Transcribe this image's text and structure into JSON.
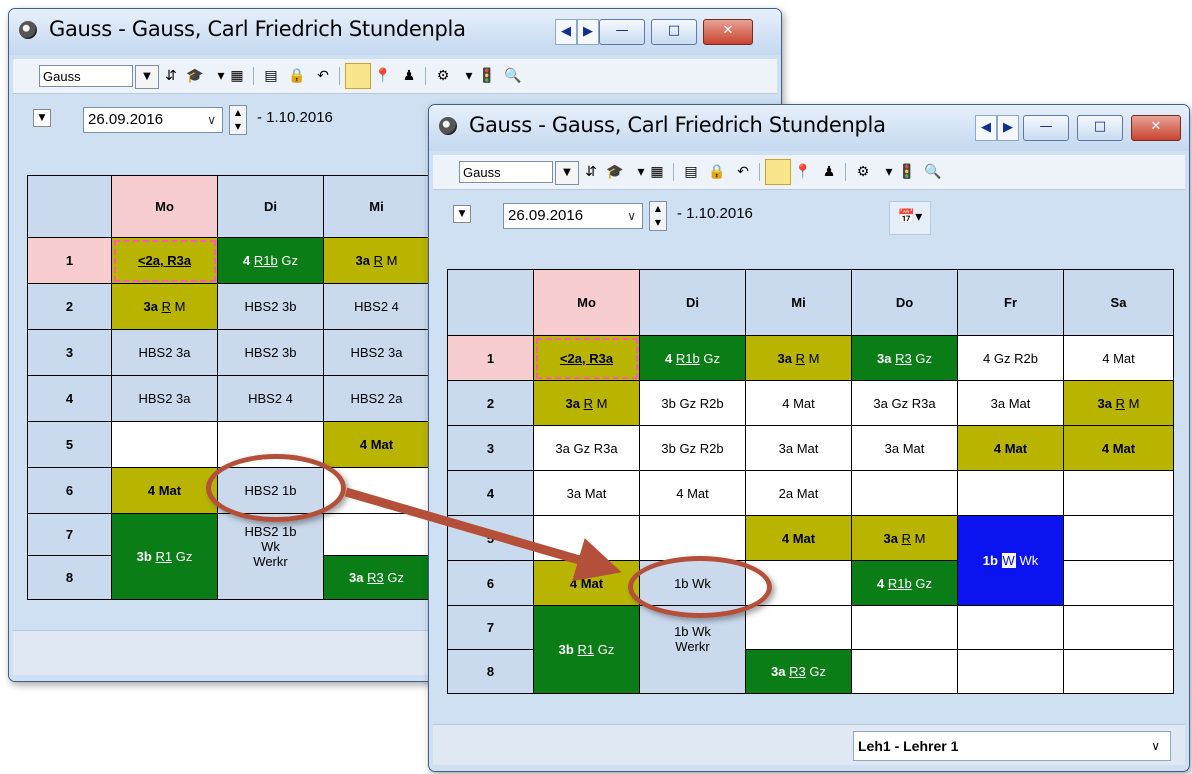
{
  "window": {
    "title": "Gauss - Gauss, Carl Friedrich  Stundenpla",
    "minimize_label": "—",
    "maximize_label": "□",
    "close_label": "✕",
    "prev_label": "◀",
    "next_label": "▶"
  },
  "toolbar": {
    "teacher_select": "Gauss"
  },
  "date": {
    "value": "26.09.2016",
    "end": "- 1.10.2016"
  },
  "grid": {
    "days": [
      "Mo",
      "Di",
      "Mi",
      "Do",
      "Fr",
      "Sa"
    ],
    "periods": [
      "1",
      "2",
      "3",
      "4",
      "5",
      "6",
      "7",
      "8"
    ]
  },
  "cells_back": {
    "r1_mo": "˂2a, R3a",
    "r1_di_a": "4",
    "r1_di_b": "R1b",
    "r1_di_c": "Gz",
    "r1_mi_a": "3a",
    "r1_mi_b": "R",
    "r1_mi_c": "M",
    "r2_mo_a": "3a",
    "r2_mo_b": "R",
    "r2_mo_c": "M",
    "r2_di": "HBS2 3b",
    "r2_mi": "HBS2 4",
    "r3_mo": "HBS2 3a",
    "r3_di": "HBS2 3b",
    "r3_mi": "HBS2 3a",
    "r4_mo": "HBS2 3a",
    "r4_di": "HBS2 4",
    "r4_mi": "HBS2 2a",
    "r5_mi": "4  Mat",
    "r6_mo": "4  Mat",
    "r6_di": "HBS2 1b",
    "r78_mo_a": "3b",
    "r78_mo_b": "R1",
    "r78_mo_c": "Gz",
    "r7_di_1": "HBS2 1b",
    "r7_di_2": "Wk",
    "r7_di_3": "Werkr",
    "r8_mi_a": "3a",
    "r8_mi_b": "R3",
    "r8_mi_c": "Gz"
  },
  "cells_front": {
    "r1_mo": "˂2a, R3a",
    "r1_di_a": "4",
    "r1_di_b": "R1b",
    "r1_di_c": "Gz",
    "r1_mi_a": "3a",
    "r1_mi_b": "R",
    "r1_mi_c": "M",
    "r1_do_a": "3a",
    "r1_do_b": "R3",
    "r1_do_c": "Gz",
    "r1_fr": "4 Gz R2b",
    "r1_sa": "4 Mat",
    "r2_mo_a": "3a",
    "r2_mo_b": "R",
    "r2_mo_c": "M",
    "r2_di": "3b Gz R2b",
    "r2_mi": "4 Mat",
    "r2_do": "3a Gz R3a",
    "r2_fr": "3a Mat",
    "r2_sa_a": "3a",
    "r2_sa_b": "R",
    "r2_sa_c": "M",
    "r3_mo": "3a Gz R3a",
    "r3_di": "3b Gz R2b",
    "r3_mi": "3a Mat",
    "r3_do": "3a Mat",
    "r3_fr": "4  Mat",
    "r3_sa": "4  Mat",
    "r4_mo": "3a Mat",
    "r4_di": "4 Mat",
    "r4_mi": "2a Mat",
    "r5_mi": "4  Mat",
    "r5_do_a": "3a",
    "r5_do_b": "R",
    "r5_do_c": "M",
    "r56_fr_a": "1b",
    "r56_fr_b": "W",
    "r56_fr_c": "Wk",
    "r6_mo": "4  Mat",
    "r6_di": "1b Wk",
    "r6_do_a": "4",
    "r6_do_b": "R1b",
    "r6_do_c": "Gz",
    "r78_mo_a": "3b",
    "r78_mo_b": "R1",
    "r78_mo_c": "Gz",
    "r7_di_1": "1b Wk",
    "r7_di_2": "Werkr",
    "r8_mi_a": "3a",
    "r8_mi_b": "R3",
    "r8_mi_c": "Gz"
  },
  "status": {
    "teacher": "Leh1 - Lehrer 1"
  },
  "colors": {
    "olive": "#b8b400",
    "green": "#0a7d17",
    "blue": "#0a13f0",
    "header_blue": "#c9d9ee",
    "header_pink": "#f7cdd0",
    "arrow": "#b4503a"
  }
}
